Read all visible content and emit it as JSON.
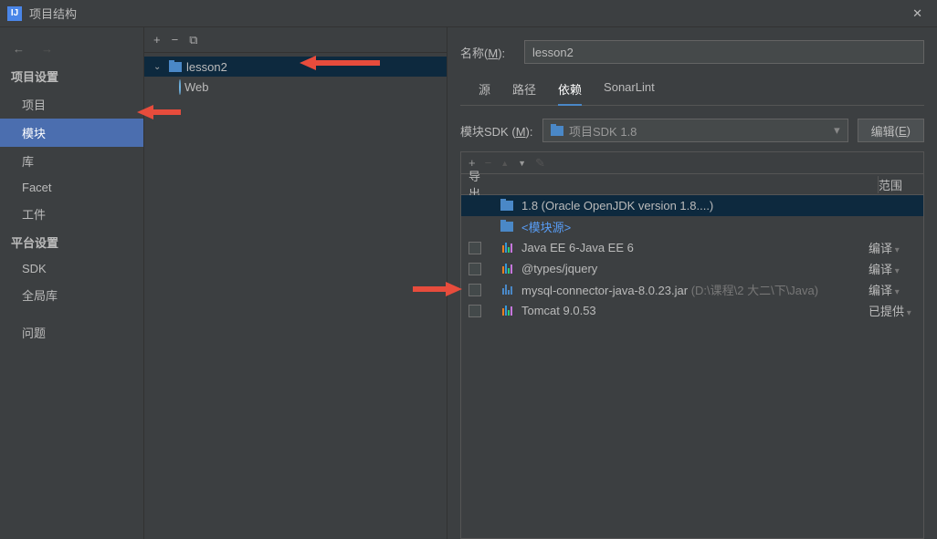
{
  "titlebar": {
    "title": "项目结构"
  },
  "nav": {
    "back_label": "←",
    "fwd_label": "→"
  },
  "leftnav": {
    "section1": "项目设置",
    "items1": [
      "项目",
      "模块",
      "库",
      "Facet",
      "工件"
    ],
    "section2": "平台设置",
    "items2": [
      "SDK",
      "全局库"
    ],
    "problems": "问题"
  },
  "midpanel": {
    "add_label": "+",
    "remove_label": "−",
    "copy_label": "⧉",
    "tree": {
      "root": "lesson2",
      "child1": "Web"
    }
  },
  "rightpanel": {
    "name_label": "名称",
    "name_underline": "M",
    "name_value": "lesson2",
    "tabs": [
      "源",
      "路径",
      "依赖",
      "SonarLint"
    ],
    "sdk_label": "模块SDK ",
    "sdk_underline": "M",
    "sdk_value": "项目SDK 1.8",
    "edit_label": "编辑",
    "edit_underline": "E",
    "deptoolbar": {
      "add": "+",
      "remove": "−",
      "up": "▲",
      "down": "▼",
      "edit": "✎"
    },
    "header": {
      "export": "导出",
      "scope": "范围"
    },
    "rows": [
      {
        "checkbox": false,
        "icon": "folder-blue",
        "name": "1.8 (Oracle OpenJDK version 1.8....)",
        "path": "",
        "scope": "",
        "selected": true
      },
      {
        "checkbox": false,
        "icon": "folder-blue",
        "name": "<模块源>",
        "path": "",
        "scope": "",
        "module_src": true
      },
      {
        "checkbox": true,
        "icon": "lib",
        "name": "Java EE 6-Java EE 6",
        "path": "",
        "scope": "编译",
        "scope_arrow": true
      },
      {
        "checkbox": true,
        "icon": "lib-yellow",
        "name": "@types/jquery",
        "path": "",
        "scope": "编译",
        "scope_arrow": true
      },
      {
        "checkbox": true,
        "icon": "jar",
        "name": "mysql-connector-java-8.0.23.jar",
        "path": " (D:\\课程\\2 大二\\下\\Java)",
        "scope": "编译",
        "scope_arrow": true
      },
      {
        "checkbox": true,
        "icon": "lib",
        "name": "Tomcat 9.0.53",
        "path": "",
        "scope": "已提供",
        "scope_arrow": true
      }
    ]
  }
}
